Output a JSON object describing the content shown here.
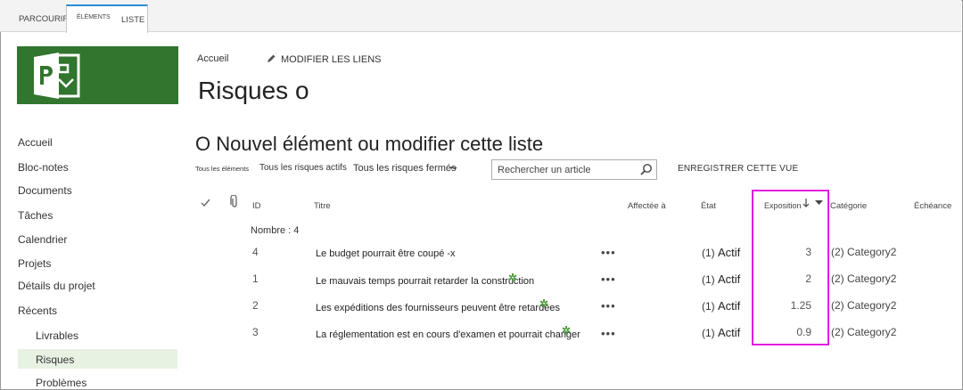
{
  "ribbon": {
    "tab_browse": "PARCOURIR",
    "tab_items": "ÉLÉMENTS",
    "tab_list": "LISTE"
  },
  "nav": {
    "items": [
      "Accueil",
      "Bloc-notes",
      "Documents",
      "Tâches",
      "Calendrier",
      "Projets",
      "Détails du projet",
      "Récents"
    ],
    "sub_items": [
      "Livrables",
      "Risques",
      "Problèmes"
    ],
    "selected": "Risques"
  },
  "header": {
    "breadcrumb": "Accueil",
    "edit_links": "MODIFIER LES LIENS",
    "title": "Risques o"
  },
  "list": {
    "new_item": "O Nouvel élément ou modifier cette liste",
    "views": [
      "Tous les éléments",
      "Tous les risques actifs",
      "Tous les risques fermés"
    ],
    "view_more": "•••",
    "search_placeholder": "Rechercher un article",
    "save_view": "ENREGISTRER CETTE VUE",
    "columns": {
      "id": "ID",
      "title": "Titre",
      "assigned": "Affectée à",
      "state": "État",
      "exposure": "Exposition",
      "category": "Catégorie",
      "due": "Échéance"
    },
    "count": "Nombre : 4",
    "rows": [
      {
        "id": "4",
        "title": "Le budget pourrait être coupé -x",
        "state_prefix": "(1)",
        "state": "Actif",
        "exposure": "3",
        "category": "(2) Category2",
        "new_mark": false
      },
      {
        "id": "1",
        "title": "Le mauvais temps pourrait retarder la construction",
        "state_prefix": "(1)",
        "state": "Actif",
        "exposure": "2",
        "category": "(2) Category2",
        "new_mark": true
      },
      {
        "id": "2",
        "title": "Les expéditions des fournisseurs peuvent être retardées",
        "state_prefix": "(1)",
        "state": "Actif",
        "exposure": "1.25",
        "category": "(2) Category2",
        "new_mark": true
      },
      {
        "id": "3",
        "title": "La réglementation est en cours d'examen et pourrait changer",
        "state_prefix": "(1)",
        "state": "Actif",
        "exposure": "0.9",
        "category": "(2) Category2",
        "new_mark": true
      }
    ],
    "row_menu": "•••",
    "new_badge": "✲"
  },
  "colors": {
    "brand_green": "#31752f",
    "highlight_magenta": "#e31be3",
    "ribbon_accent": "#2a8dd4"
  }
}
